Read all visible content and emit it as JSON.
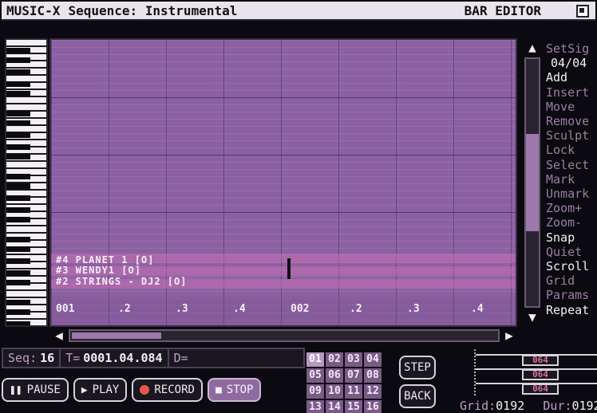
{
  "title": {
    "app": "MUSIC-X",
    "sequence": "Sequence: Instrumental",
    "mode": "BAR EDITOR"
  },
  "tools": {
    "setsig_label": "SetSig",
    "setsig_value": "04/04",
    "items": [
      {
        "label": "Add",
        "enabled": true
      },
      {
        "label": "Insert",
        "enabled": false
      },
      {
        "label": "Move",
        "enabled": false
      },
      {
        "label": "Remove",
        "enabled": false
      },
      {
        "label": "Sculpt",
        "enabled": false
      },
      {
        "label": "Lock",
        "enabled": false
      },
      {
        "label": "Select",
        "enabled": false
      },
      {
        "label": "Mark",
        "enabled": false
      },
      {
        "label": "Unmark",
        "enabled": false
      },
      {
        "label": "Zoom+",
        "enabled": false
      },
      {
        "label": "Zoom-",
        "enabled": false
      },
      {
        "label": "Snap",
        "enabled": true
      },
      {
        "label": "Quiet",
        "enabled": false
      },
      {
        "label": "Scroll",
        "enabled": true
      },
      {
        "label": "Grid",
        "enabled": false
      },
      {
        "label": "Params",
        "enabled": false
      },
      {
        "label": "Repeat",
        "enabled": true
      }
    ]
  },
  "tracks": [
    "#4 PLANET 1 [O]",
    "#3 WENDY1 [O]",
    "#2 STRINGS - DJ2 [O]"
  ],
  "beats": [
    "001",
    ".2",
    ".3",
    ".4",
    "002",
    ".2",
    ".3",
    ".4"
  ],
  "status": {
    "seq_label": "Seq:",
    "seq_value": "16",
    "time_label": "T=",
    "time_value": "0001.04.084",
    "d_label": "D="
  },
  "transport": {
    "pause": "PAUSE",
    "play": "PLAY",
    "record": "RECORD",
    "stop": "STOP"
  },
  "pads": [
    "01",
    "02",
    "03",
    "04",
    "05",
    "06",
    "07",
    "08",
    "09",
    "10",
    "11",
    "12",
    "13",
    "14",
    "15",
    "16"
  ],
  "step_label": "STEP",
  "back_label": "BACK",
  "velocities": [
    "064",
    "064",
    "064"
  ],
  "grid_label": "Grid:",
  "grid_value": "0192",
  "dur_label": "Dur:",
  "dur_value": "0192"
}
